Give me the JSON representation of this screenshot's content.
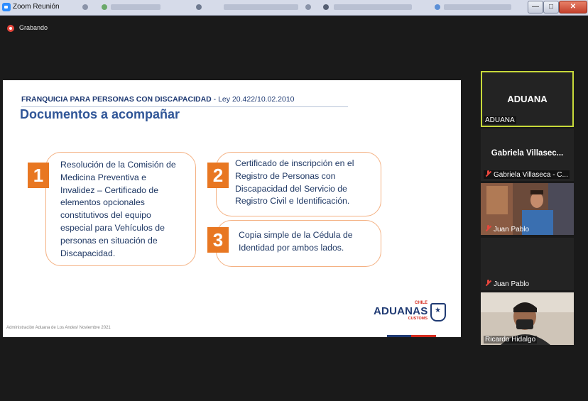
{
  "window": {
    "title": "Zoom Reunión",
    "buttons": {
      "minimize": "—",
      "maximize": "□",
      "close": "✕"
    }
  },
  "recording": {
    "label": "Grabando"
  },
  "slide": {
    "header_bold": "FRANQUICIA PARA PERSONAS CON DISCAPACIDAD",
    "header_rest": " - Ley 20.422/10.02.2010",
    "title": "Documentos a acompañar",
    "documents": [
      {
        "number": "1",
        "lines": [
          "Resolución de la Comisión de",
          "Medicina Preventiva e",
          "Invalidez – Certificado de",
          "elementos opcionales",
          "constitutivos del equipo",
          "especial para Vehículos de",
          "personas en situación de",
          "Discapacidad."
        ]
      },
      {
        "number": "2",
        "lines": [
          "Certificado de inscripción en el",
          "Registro de Personas con",
          "Discapacidad del Servicio de",
          "Registro Civil e Identificación."
        ]
      },
      {
        "number": "3",
        "lines": [
          "Copia simple de la Cédula de",
          "Identidad por ambos lados."
        ]
      }
    ],
    "footer": "Administración Aduana de Los Andes/ Noviembre 2021",
    "logo": {
      "chile": "CHILE",
      "name": "ADUANAS",
      "customs": "CUSTOMS"
    }
  },
  "participants": [
    {
      "display": "ADUANA",
      "label": "ADUANA",
      "muted": false,
      "video": false,
      "active": true
    },
    {
      "display": "Gabriela  Villasec...",
      "label": "Gabriela Villaseca - C...",
      "muted": true,
      "video": false,
      "active": false
    },
    {
      "display": "",
      "label": "Juan Pablo",
      "muted": true,
      "video": true,
      "active": false
    },
    {
      "display": "",
      "label": "Juan Pablo",
      "muted": true,
      "video": false,
      "active": false
    },
    {
      "display": "",
      "label": "Ricardo Hidalgo",
      "muted": false,
      "video": true,
      "active": false
    }
  ],
  "colors": {
    "accent_orange": "#e87722",
    "slide_blue": "#2f5597",
    "active_border": "#c7d93a",
    "recording_red": "#e6463c"
  }
}
